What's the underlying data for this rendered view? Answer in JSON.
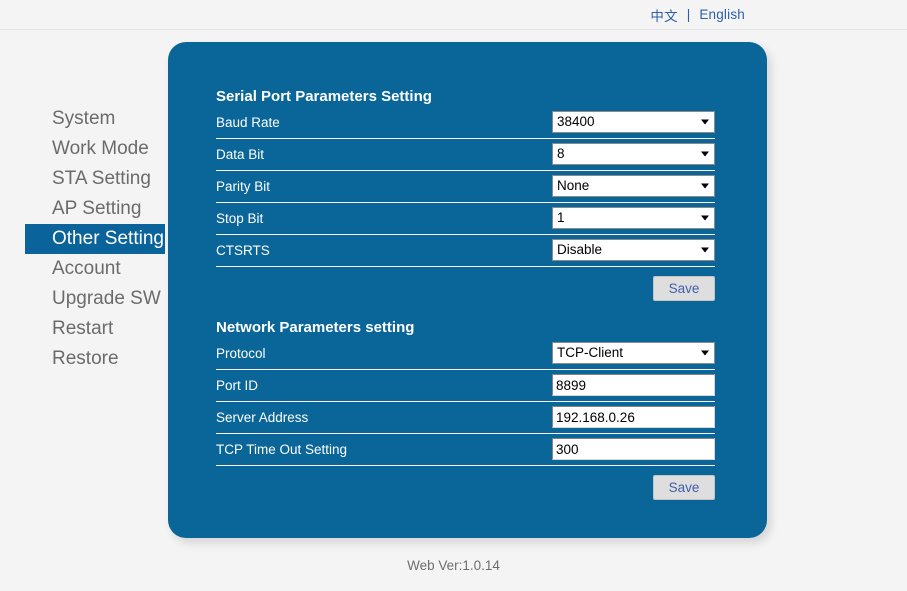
{
  "header": {
    "lang_chinese": "中文",
    "lang_separator": "|",
    "lang_english": "English"
  },
  "sidebar": {
    "items": [
      {
        "label": "System",
        "active": false
      },
      {
        "label": "Work Mode",
        "active": false
      },
      {
        "label": "STA Setting",
        "active": false
      },
      {
        "label": "AP Setting",
        "active": false
      },
      {
        "label": "Other Setting",
        "active": true
      },
      {
        "label": "Account",
        "active": false
      },
      {
        "label": "Upgrade SW",
        "active": false
      },
      {
        "label": "Restart",
        "active": false
      },
      {
        "label": "Restore",
        "active": false
      }
    ]
  },
  "serial_section": {
    "title": "Serial Port Parameters Setting",
    "rows": [
      {
        "label": "Baud Rate",
        "value": "38400",
        "type": "select"
      },
      {
        "label": "Data Bit",
        "value": "8",
        "type": "select"
      },
      {
        "label": "Parity Bit",
        "value": "None",
        "type": "select"
      },
      {
        "label": "Stop Bit",
        "value": "1",
        "type": "select"
      },
      {
        "label": "CTSRTS",
        "value": "Disable",
        "type": "select"
      }
    ],
    "save_label": "Save"
  },
  "network_section": {
    "title": "Network Parameters setting",
    "rows": [
      {
        "label": "Protocol",
        "value": "TCP-Client",
        "type": "select"
      },
      {
        "label": "Port ID",
        "value": "8899",
        "type": "text"
      },
      {
        "label": "Server Address",
        "value": "192.168.0.26",
        "type": "text"
      },
      {
        "label": "TCP Time Out Setting",
        "value": "300",
        "type": "text"
      }
    ],
    "save_label": "Save"
  },
  "footer": {
    "version": "Web Ver:1.0.14"
  },
  "colors": {
    "panel_blue": "#0a6699",
    "active_nav": "#0a649b",
    "link_blue": "#2b5faa",
    "save_text": "#3f5fa8",
    "save_bg": "#dedede",
    "page_bg": "#f4f4f4"
  }
}
